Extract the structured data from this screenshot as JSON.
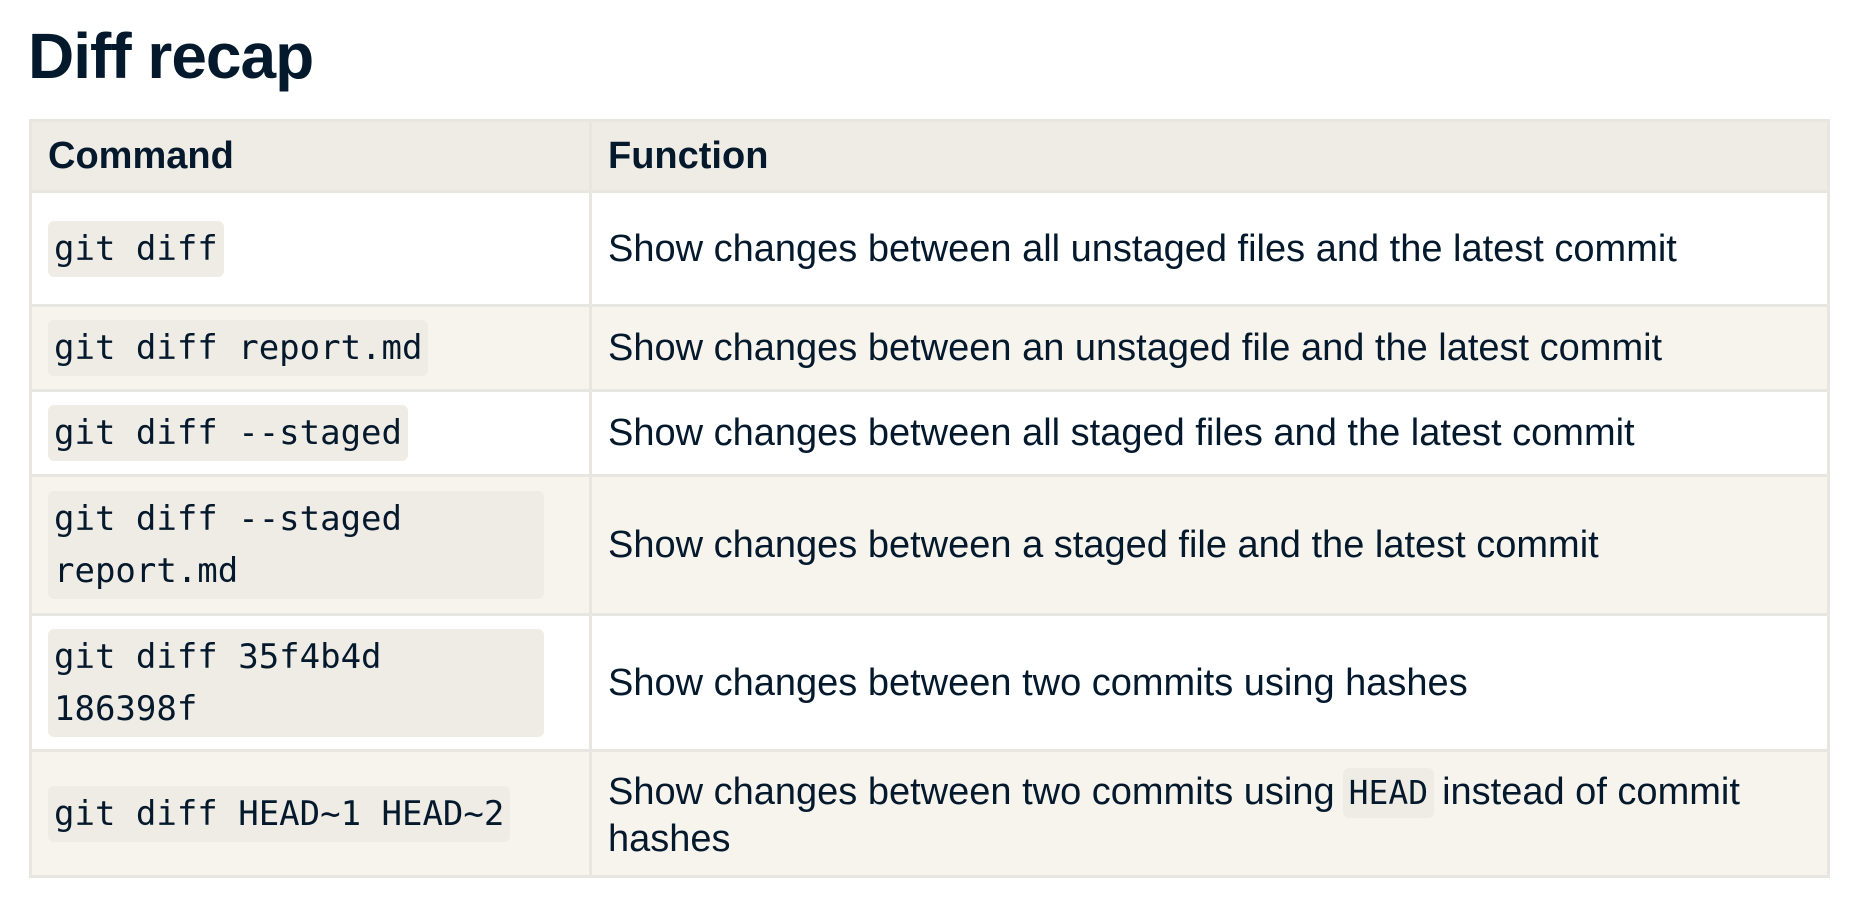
{
  "title": "Diff recap",
  "table": {
    "headers": {
      "command": "Command",
      "function": "Function"
    },
    "rows": [
      {
        "command": "git diff",
        "function": "Show changes between all unstaged files and the latest commit"
      },
      {
        "command": "git diff report.md",
        "function": "Show changes between an unstaged file and the latest commit"
      },
      {
        "command": "git diff --staged",
        "function": "Show changes between all staged files and the latest commit"
      },
      {
        "command": "git diff --staged report.md",
        "function": "Show changes between a staged file and the latest commit"
      },
      {
        "command": "git diff 35f4b4d 186398f",
        "function": "Show changes between two commits using hashes"
      },
      {
        "command": "git diff HEAD~1 HEAD~2",
        "function_before": "Show changes between two commits using",
        "function_code": "HEAD",
        "function_after": "instead of commit hashes"
      }
    ]
  },
  "colors": {
    "text": "#05192d",
    "header_bg": "#efebe5",
    "row_alt_bg": "#f7f4ee",
    "code_bg": "#efebe5",
    "border": "#e8e6e0"
  }
}
